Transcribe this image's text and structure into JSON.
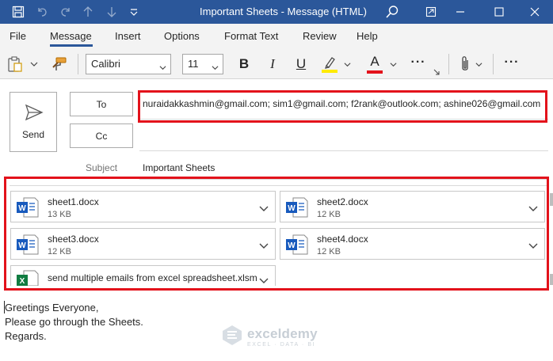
{
  "window": {
    "title": "Important Sheets  -  Message (HTML)"
  },
  "menu": {
    "items": [
      "File",
      "Message",
      "Insert",
      "Options",
      "Format Text",
      "Review",
      "Help"
    ],
    "active": "Message"
  },
  "ribbon": {
    "font_name": "Calibri",
    "font_size": "11",
    "bold": "B",
    "italic": "I",
    "underline": "U",
    "font_color_letter": "A",
    "more": "···",
    "highlight_color": "#ffeb00",
    "font_color": "#e3121b"
  },
  "compose": {
    "send_label": "Send",
    "to_label": "To",
    "cc_label": "Cc",
    "to_value": "nuraidakkashmin@gmail.com; sim1@gmail.com; f2rank@outlook.com; ashine026@gmail.com",
    "subject_label": "Subject",
    "subject_value": "Important Sheets"
  },
  "attachments": [
    {
      "name": "sheet1.docx",
      "size": "13 KB",
      "type": "word"
    },
    {
      "name": "sheet2.docx",
      "size": "12 KB",
      "type": "word"
    },
    {
      "name": "sheet3.docx",
      "size": "12 KB",
      "type": "word"
    },
    {
      "name": "sheet4.docx",
      "size": "12 KB",
      "type": "word"
    },
    {
      "name": "send multiple emails from excel spreadsheet.xlsm",
      "size": "",
      "type": "excel"
    }
  ],
  "body": {
    "lines": [
      "Greetings Everyone,",
      "Please go through the Sheets.",
      "Regards."
    ]
  },
  "watermark": {
    "name": "exceldemy",
    "tagline": "EXCEL · DATA · BI"
  },
  "colors": {
    "titlebar": "#2b579a",
    "highlight_box": "#e3121b",
    "word_blue": "#185abd",
    "excel_green": "#107c41"
  }
}
